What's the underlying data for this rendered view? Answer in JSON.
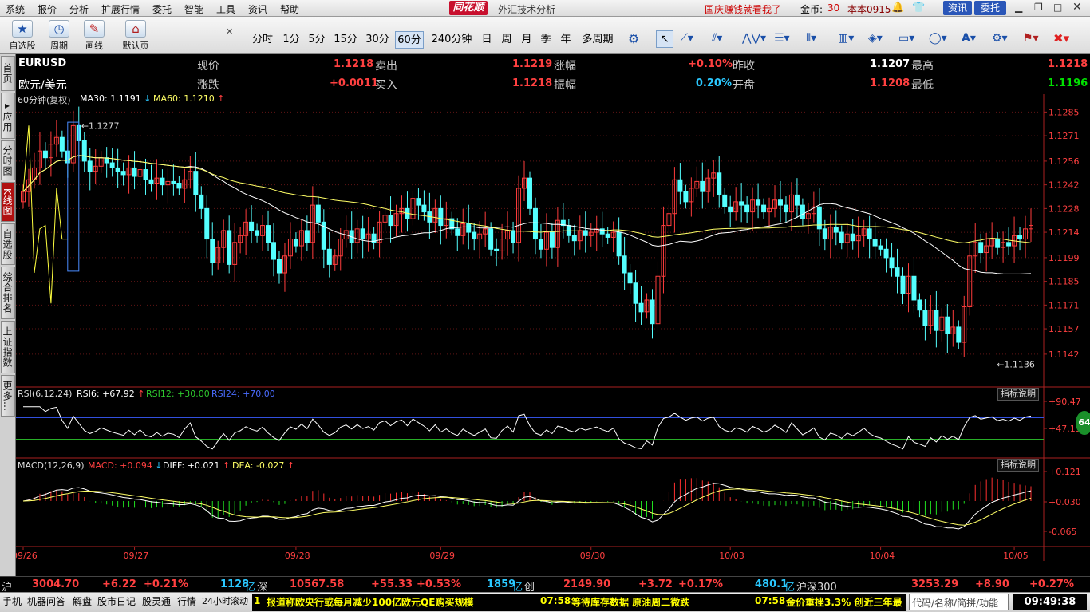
{
  "menu": {
    "items": [
      "系统",
      "报价",
      "分析",
      "扩展行情",
      "委托",
      "智能",
      "工具",
      "资讯",
      "帮助"
    ],
    "logo": "同花顺",
    "title": "- 外汇技术分析",
    "promo": "国庆赚钱就看我了",
    "coin_label": "金币:",
    "coin_value": "30",
    "version": "本本0915",
    "btn_news": "资讯",
    "btn_trade": "委托",
    "colors": {
      "news": "#2a56b8",
      "trade": "#2a56b8"
    }
  },
  "toolbar": {
    "big": [
      {
        "name": "watchlist",
        "label": "自选股",
        "icon": "star-icon"
      },
      {
        "name": "period",
        "label": "周期",
        "icon": "clock-icon"
      },
      {
        "name": "draw",
        "label": "画线",
        "icon": "pencil-icon"
      },
      {
        "name": "home",
        "label": "默认页",
        "icon": "house-icon"
      }
    ],
    "periods": [
      "分时",
      "1分",
      "5分",
      "15分",
      "30分",
      "60分",
      "240分钟",
      "日",
      "周",
      "月",
      "季",
      "年",
      "多周期"
    ],
    "selected_period": "60分"
  },
  "left_tabs": [
    "首页",
    "应用",
    "分时图",
    "K线图",
    "自选股",
    "综合排名",
    "上证指数",
    "更多"
  ],
  "quote": {
    "symbol": "EURUSD",
    "name": "欧元/美元",
    "labels": {
      "price": "现价",
      "change": "涨跌",
      "sell": "卖出",
      "buy": "买入",
      "pct": "涨幅",
      "amp": "振幅",
      "prev": "昨收",
      "open": "开盘",
      "high": "最高",
      "low": "最低"
    },
    "price": "1.1218",
    "change": "+0.0011",
    "sell": "1.1219",
    "buy": "1.1218",
    "pct": "+0.10%",
    "amp": "0.20%",
    "prev": "1.1207",
    "open": "1.1208",
    "high": "1.1218",
    "low": "1.1196"
  },
  "main_indicator": {
    "period_label": "60分钟(复权)",
    "ma30_label": "MA30: 1.1191",
    "ma60_label": "MA60: 1.1210",
    "high_mark": "1.1277",
    "low_mark": "1.1136"
  },
  "rsi": {
    "title": "RSI(6,12,24)",
    "rsi6": "RSI6: +67.92",
    "rsi12": "RSI12: +30.00",
    "rsi24": "RSI24: +70.00",
    "help": "指标说明",
    "axis": [
      "+90.47",
      "+47.13"
    ],
    "bubble": "64"
  },
  "macd": {
    "title": "MACD(12,26,9)",
    "macd": "MACD: +0.094",
    "diff": "DIFF: +0.021",
    "dea": "DEA: -0.027",
    "help": "指标说明",
    "axis": [
      "+0.121",
      "+0.030",
      "-0.065"
    ]
  },
  "chart_data": {
    "type": "candlestick",
    "y_ticks": [
      1.1285,
      1.1271,
      1.1256,
      1.1242,
      1.1228,
      1.1214,
      1.1199,
      1.1185,
      1.1171,
      1.1157,
      1.1142
    ],
    "ylim": [
      1.1133,
      1.1288
    ],
    "x_labels": [
      {
        "label": "09/26",
        "i": 0
      },
      {
        "label": "09/27",
        "i": 20
      },
      {
        "label": "09/28",
        "i": 49
      },
      {
        "label": "09/29",
        "i": 75
      },
      {
        "label": "09/30",
        "i": 102
      },
      {
        "label": "10/03",
        "i": 127
      },
      {
        "label": "10/04",
        "i": 154
      },
      {
        "label": "10/05",
        "i": 178
      }
    ],
    "close": [
      1.1238,
      1.1245,
      1.1252,
      1.1262,
      1.1258,
      1.1266,
      1.127,
      1.1262,
      1.1255,
      1.1277,
      1.1268,
      1.1256,
      1.125,
      1.1253,
      1.1258,
      1.1255,
      1.1252,
      1.125,
      1.1248,
      1.1252,
      1.1247,
      1.1251,
      1.1245,
      1.1243,
      1.1246,
      1.1242,
      1.1244,
      1.1243,
      1.124,
      1.1245,
      1.125,
      1.1236,
      1.1228,
      1.121,
      1.1196,
      1.1205,
      1.1215,
      1.1195,
      1.1208,
      1.1212,
      1.122,
      1.1215,
      1.1212,
      1.1218,
      1.1208,
      1.1198,
      1.119,
      1.12,
      1.121,
      1.1206,
      1.1215,
      1.1208,
      1.123,
      1.122,
      1.1204,
      1.1195,
      1.12,
      1.121,
      1.1215,
      1.1208,
      1.1216,
      1.121,
      1.1213,
      1.1208,
      1.122,
      1.1224,
      1.1218,
      1.1225,
      1.1228,
      1.1222,
      1.1234,
      1.123,
      1.1226,
      1.122,
      1.1228,
      1.1218,
      1.1222,
      1.1216,
      1.1212,
      1.1219,
      1.1214,
      1.121,
      1.1213,
      1.1216,
      1.1204,
      1.1203,
      1.121,
      1.1215,
      1.1208,
      1.124,
      1.1246,
      1.1228,
      1.121,
      1.1204,
      1.1214,
      1.1205,
      1.1221,
      1.1218,
      1.1212,
      1.1209,
      1.1215,
      1.1212,
      1.1214,
      1.1216,
      1.1213,
      1.1211,
      1.1214,
      1.12,
      1.119,
      1.1184,
      1.1172,
      1.1167,
      1.1174,
      1.116,
      1.1188,
      1.1218,
      1.1225,
      1.1245,
      1.1238,
      1.1232,
      1.124,
      1.1244,
      1.1238,
      1.1246,
      1.1249,
      1.1236,
      1.1229,
      1.1226,
      1.1232,
      1.123,
      1.1226,
      1.1233,
      1.123,
      1.1226,
      1.1228,
      1.1233,
      1.123,
      1.1226,
      1.1236,
      1.123,
      1.1222,
      1.1225,
      1.1229,
      1.1216,
      1.121,
      1.1217,
      1.1214,
      1.1208,
      1.1213,
      1.1209,
      1.1212,
      1.1216,
      1.121,
      1.1206,
      1.1204,
      1.1199,
      1.1193,
      1.1188,
      1.1178,
      1.1188,
      1.1174,
      1.1168,
      1.1159,
      1.1168,
      1.1156,
      1.1164,
      1.1154,
      1.1158,
      1.1149,
      1.117,
      1.12,
      1.1208,
      1.1202,
      1.1206,
      1.121,
      1.1205,
      1.1208,
      1.1206,
      1.1212,
      1.121,
      1.1216,
      1.1218
    ],
    "ma30_label_value": 1.1191,
    "ma60_label_value": 1.121,
    "rsi_bands": [
      70,
      30
    ],
    "macd_range": [
      -0.11,
      0.15
    ],
    "colors": {
      "up": "#ff3c3c",
      "down": "#54ffff",
      "ma30": "#ffffff",
      "ma60": "#ffff66",
      "zigzag": "#ffff40",
      "highlight": "#4a8cff"
    }
  },
  "status": {
    "sh_label": "沪",
    "sh_val": "3004.70",
    "sh_chg": "+6.22",
    "sh_pct": "+0.21%",
    "sh_amt": "1128",
    "yi": "亿",
    "sz_label": "深",
    "sz_val": "10567.58",
    "sz_chg": "+55.33",
    "sz_pct": "+0.53%",
    "sz_amt": "1859",
    "cy_label": "创",
    "cy_val": "2149.90",
    "cy_chg": "+3.72",
    "cy_pct": "+0.17%",
    "cy_amt": "480.1",
    "hs_label": "沪深300",
    "hs_val": "3253.29",
    "hs_chg": "+8.90",
    "hs_pct": "+0.27%"
  },
  "bottom": {
    "items": [
      "手机",
      "机器问答",
      "解盘",
      "股市日记",
      "股灵通",
      "行情",
      "24小时滚动"
    ],
    "ticker": [
      {
        "time": "1",
        "text": "报道称欧央行或每月减少100亿欧元QE购买规模"
      },
      {
        "time": "07:58",
        "text": "等待库存数据 原油周二微跌"
      },
      {
        "time": "07:58",
        "text": "金价重挫3.3% 创近三年最"
      }
    ],
    "search_placeholder": "代码/名称/简拼/功能",
    "clock": "09:49:38"
  }
}
